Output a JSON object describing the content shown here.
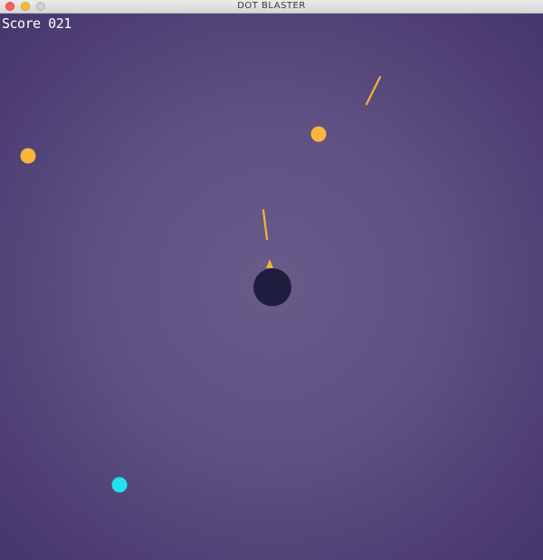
{
  "window": {
    "title": "DOT BLASTER",
    "buttons": [
      "close",
      "minimize",
      "maximize"
    ]
  },
  "hud": {
    "score_text": "Score 021"
  },
  "colors": {
    "background": "#5f5283",
    "player": "#1f1d3d",
    "player_pointer": "#f7b23b",
    "enemy_orange": "#fbb53b",
    "enemy_cyan": "#23e2ee",
    "laser": "#f7b23b"
  },
  "scene": {
    "enemies": [
      {
        "name": "enemy-dot-orange-left",
        "color": "enemy_orange"
      },
      {
        "name": "enemy-dot-orange-top",
        "color": "enemy_orange"
      },
      {
        "name": "enemy-dot-cyan",
        "color": "enemy_cyan"
      }
    ]
  }
}
